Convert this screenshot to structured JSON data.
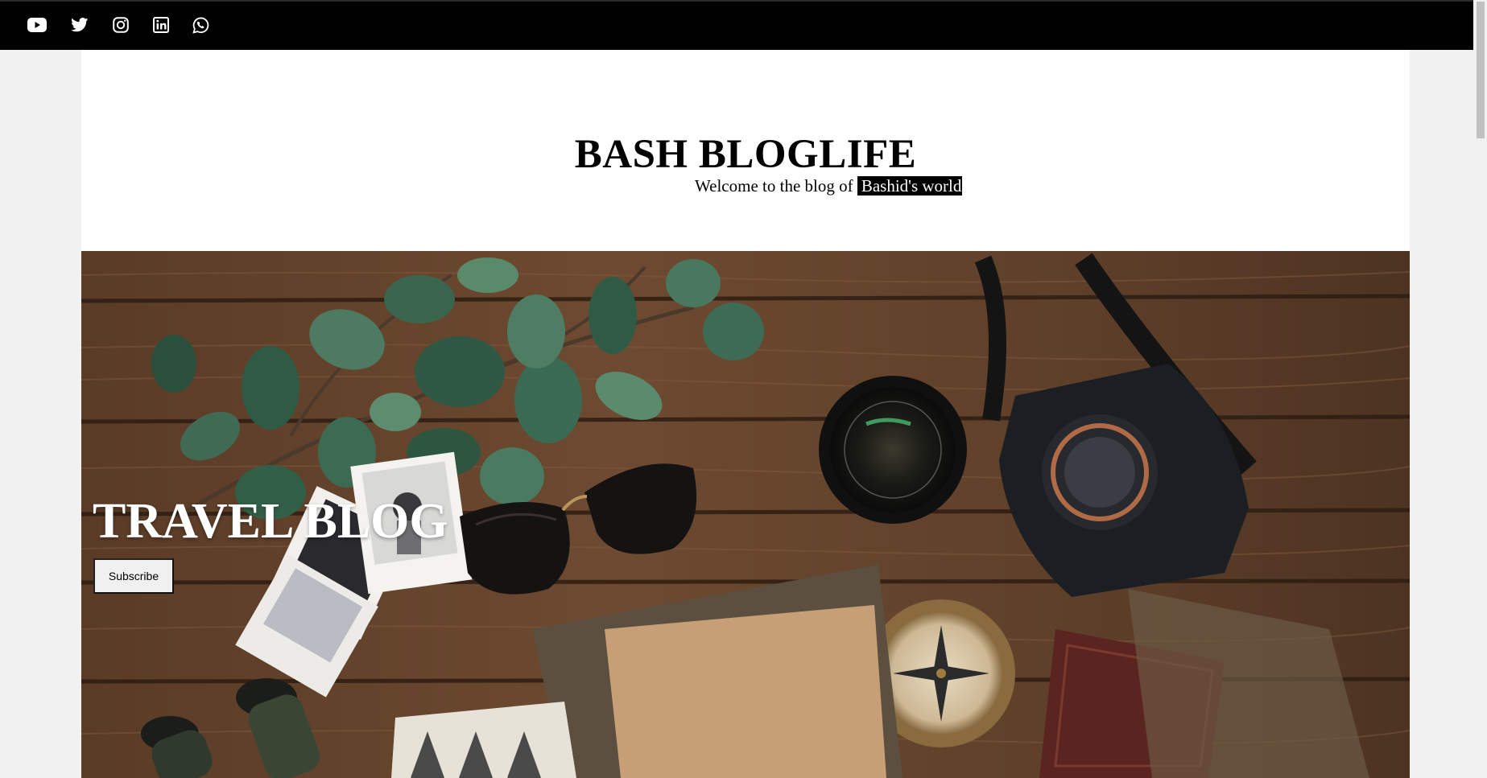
{
  "social": [
    {
      "name": "youtube-icon"
    },
    {
      "name": "twitter-icon"
    },
    {
      "name": "instagram-icon"
    },
    {
      "name": "linkedin-icon"
    },
    {
      "name": "whatsapp-icon"
    }
  ],
  "header": {
    "title": "BASH BLOGLIFE",
    "tagline_prefix": "Welcome to the blog of",
    "tagline_highlight": "Bashid's world"
  },
  "hero": {
    "title": "TRAVEL BLOG",
    "subscribe_label": "Subscribe"
  },
  "colors": {
    "topbar": "#000000",
    "page_bg": "#ffffff",
    "outer_bg": "#f1f1f1",
    "wood": "#6b4a33"
  }
}
